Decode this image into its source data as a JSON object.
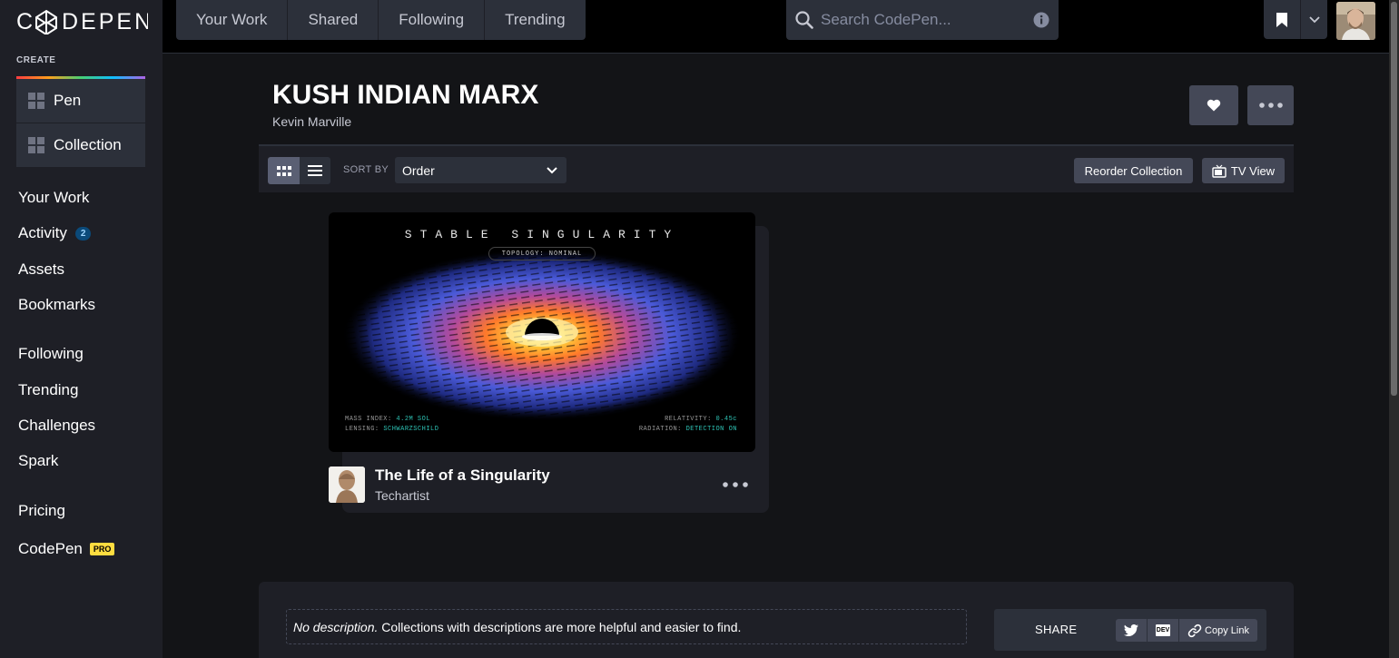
{
  "app": {
    "logo_text": "CODEPEN"
  },
  "sidebar": {
    "create_label": "CREATE",
    "create_items": [
      {
        "label": "Pen",
        "icon": "pen-icon"
      },
      {
        "label": "Collection",
        "icon": "collection-icon"
      }
    ],
    "nav": [
      {
        "label": "Your Work"
      },
      {
        "label": "Activity",
        "badge": "2"
      },
      {
        "label": "Assets"
      },
      {
        "label": "Bookmarks"
      },
      {
        "label": "Following"
      },
      {
        "label": "Trending"
      },
      {
        "label": "Challenges"
      },
      {
        "label": "Spark"
      },
      {
        "label": "Pricing"
      },
      {
        "label": "CodePen",
        "badge": "PRO"
      }
    ]
  },
  "topbar": {
    "tabs": [
      "Your Work",
      "Shared",
      "Following",
      "Trending"
    ],
    "search_placeholder": "Search CodePen..."
  },
  "collection": {
    "title": "KUSH INDIAN MARX",
    "owner": "Kevin Marville"
  },
  "toolbar": {
    "sort_by_label": "SORT BY",
    "sort_value": "Order",
    "reorder_label": "Reorder Collection",
    "tv_view_label": "TV View"
  },
  "pen": {
    "preview_title": "STABLE SINGULARITY",
    "preview_status": "TOPOLOGY: NOMINAL",
    "hud": {
      "mass_label": "MASS INDEX:",
      "mass_value": "4.2M SOL",
      "lensing_label": "LENSING:",
      "lensing_value": "SCHWARZSCHILD",
      "relativity_label": "RELATIVITY:",
      "relativity_value": "0.45c",
      "radiation_label": "RADIATION:",
      "radiation_value": "DETECTION ON"
    },
    "title": "The Life of a Singularity",
    "author": "Techartist"
  },
  "footer": {
    "desc_empty": "No description.",
    "desc_hint": " Collections with descriptions are more helpful and easier to find.",
    "share_label": "SHARE",
    "dev_label": "DEV",
    "copy_link_label": "Copy Link"
  },
  "colors": {
    "accent_teal": "#2ec4b6",
    "badge_blue": "#0b4a7a",
    "pro_yellow": "#ffdd40"
  }
}
